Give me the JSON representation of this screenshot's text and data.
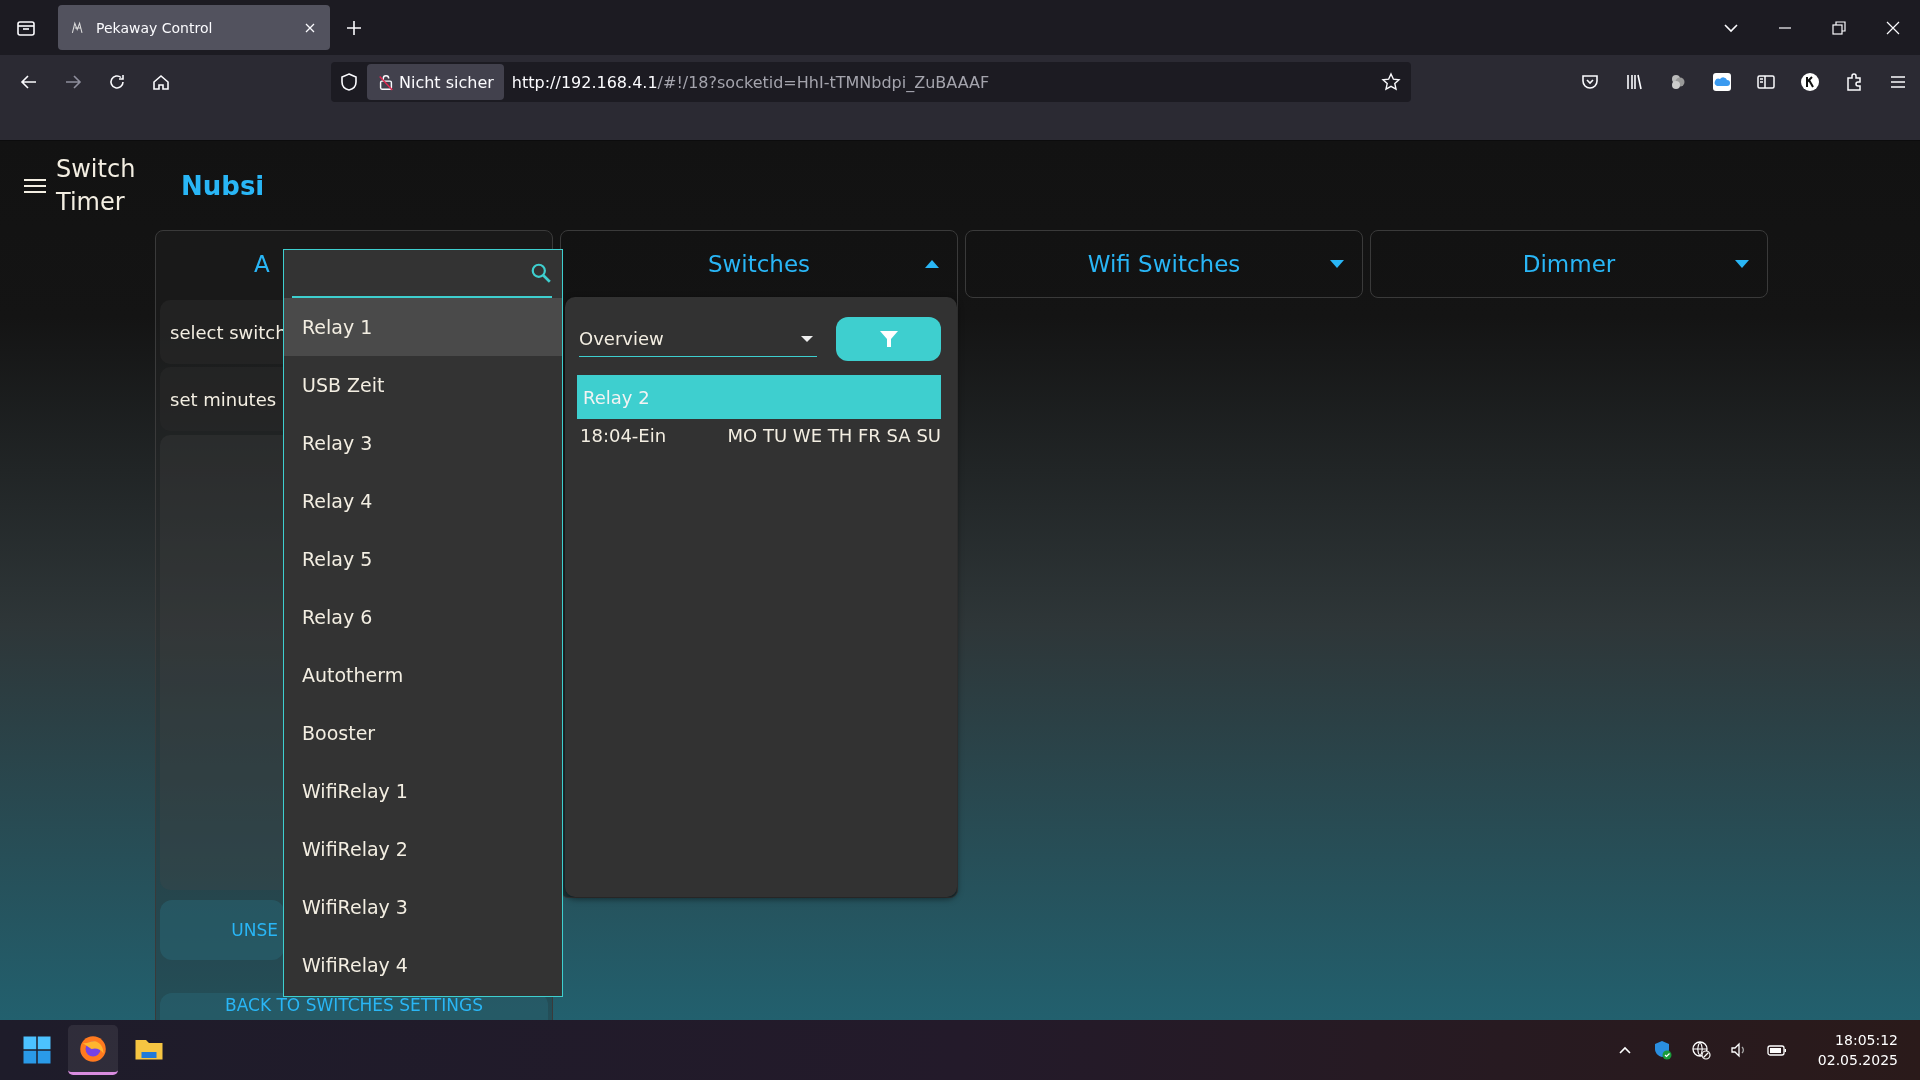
{
  "browser": {
    "tab": {
      "title": "Pekaway Control",
      "selected": true
    },
    "address": {
      "security": "Nicht sicher",
      "url_host": "http://192.168.4.1",
      "url_rest": "/#!/18?socketid=HhI-tTMNbdpi_ZuBAAAF"
    }
  },
  "app": {
    "title": "Switch Timer",
    "device": "Nubsi"
  },
  "timer_panel": {
    "title": "A",
    "rows": [
      "select switch",
      "set minutes"
    ],
    "buttons": [
      "UNSE",
      "BACK TO SWITCHES SETTINGS"
    ]
  },
  "sections": [
    {
      "title": "Switches",
      "expanded": true
    },
    {
      "title": "Wifi Switches",
      "expanded": false
    },
    {
      "title": "Dimmer",
      "expanded": false
    }
  ],
  "dropdown": {
    "items": [
      {
        "label": "Relay 1",
        "selected": true
      },
      {
        "label": "USB Zeit",
        "selected": false
      },
      {
        "label": "Relay 3",
        "selected": false
      },
      {
        "label": "Relay 4",
        "selected": false
      },
      {
        "label": "Relay 5",
        "selected": false
      },
      {
        "label": "Relay 6",
        "selected": false
      },
      {
        "label": "Autotherm",
        "selected": false
      },
      {
        "label": "Booster",
        "selected": false
      },
      {
        "label": "WifiRelay 1",
        "selected": false
      },
      {
        "label": "WifiRelay 2",
        "selected": false
      },
      {
        "label": "WifiRelay 3",
        "selected": false
      },
      {
        "label": "WifiRelay 4",
        "selected": false
      }
    ]
  },
  "switches_panel": {
    "view": "Overview",
    "group": "Relay 2",
    "entries": [
      {
        "time": "18:04-Ein",
        "days": "MO TU WE TH FR SA SU"
      }
    ]
  },
  "taskbar": {
    "time": "18:05:12",
    "date": "02.05.2025"
  }
}
